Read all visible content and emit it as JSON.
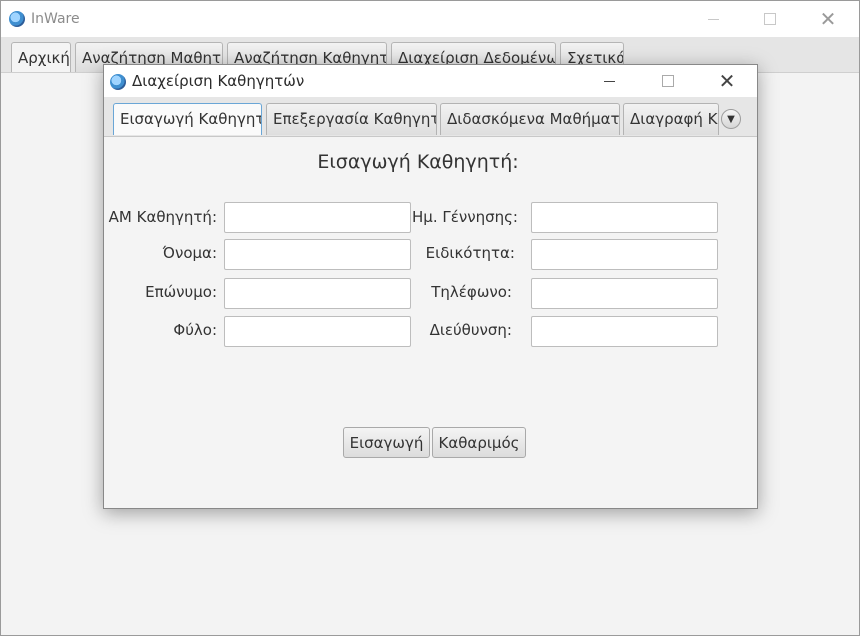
{
  "main_window": {
    "title": "InWare",
    "tabs": [
      "Αρχική",
      "Αναζήτηση Μαθητή",
      "Αναζήτηση Καθηγητή",
      "Διαχείριση Δεδομένων",
      "Σχετικά"
    ]
  },
  "dialog": {
    "title": "Διαχείριση Καθηγητών",
    "tabs": [
      "Εισαγωγή Καθηγητή",
      "Επεξεργασία Καθηγητή",
      "Διδασκόμενα Μαθήματα",
      "Διαγραφή Κα"
    ],
    "selected_tab": "Εισαγωγή Καθηγητή",
    "form": {
      "heading": "Εισαγωγή Καθηγητή:",
      "left_labels": [
        "ΑΜ Καθηγητή:",
        "Όνομα:",
        "Επώνυμο:",
        "Φύλο:"
      ],
      "right_labels": [
        "Ημ. Γέννησης:",
        "Ειδικότητα:",
        "Τηλέφωνο:",
        "Διεύθυνση:"
      ],
      "values": {
        "am": "",
        "first_name": "",
        "last_name": "",
        "gender": "",
        "birth_date": "",
        "specialty": "",
        "phone": "",
        "address": ""
      }
    },
    "buttons": {
      "insert": "Εισαγωγή",
      "clear": "Καθαριμός"
    }
  },
  "icons": {
    "app": "app-logo-icon",
    "minimize": "minimize-icon",
    "maximize": "maximize-icon",
    "close": "close-icon",
    "overflow": "chevron-down-icon"
  }
}
